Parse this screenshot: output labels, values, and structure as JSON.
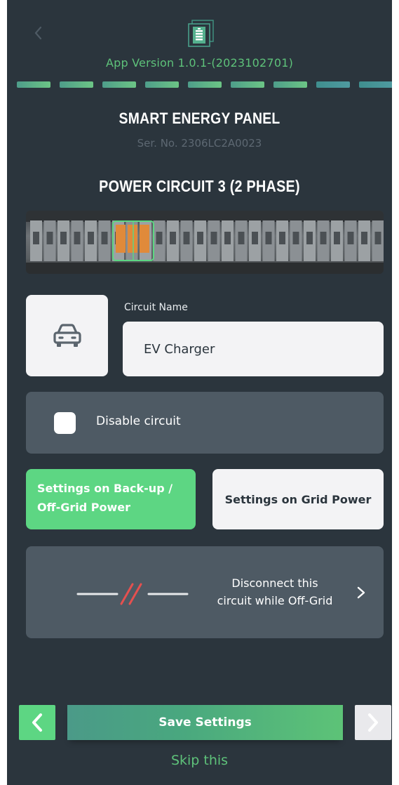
{
  "header": {
    "app_version": "App Version 1.0.1-(2023102701)",
    "progress": {
      "total_steps": 9,
      "completed_steps": 7
    }
  },
  "panel": {
    "title": "SMART ENERGY PANEL",
    "serial": "Ser. No. 2306LC2A0023"
  },
  "circuit": {
    "title": "POWER CIRCUIT 3 (2 PHASE)",
    "name_label": "Circuit Name",
    "name_value": "EV Charger",
    "icon": "car-icon",
    "disable_label": "Disable circuit",
    "disable_checked": false
  },
  "settings_tabs": {
    "backup_label_line1": "Settings on Back-up /",
    "backup_label_line2": "Off-Grid Power",
    "grid_label": "Settings on Grid Power",
    "active": "backup"
  },
  "disconnect": {
    "line1": "Disconnect this",
    "line2": "circuit while Off-Grid",
    "icon": "broken-line-icon"
  },
  "footer": {
    "save_label": "Save Settings",
    "skip_label": "Skip this"
  },
  "colors": {
    "background": "#2b353d",
    "accent_green": "#5dd683",
    "card": "#4e5a64",
    "light": "#f3f3f5",
    "disconnect_red": "#e5504f"
  }
}
